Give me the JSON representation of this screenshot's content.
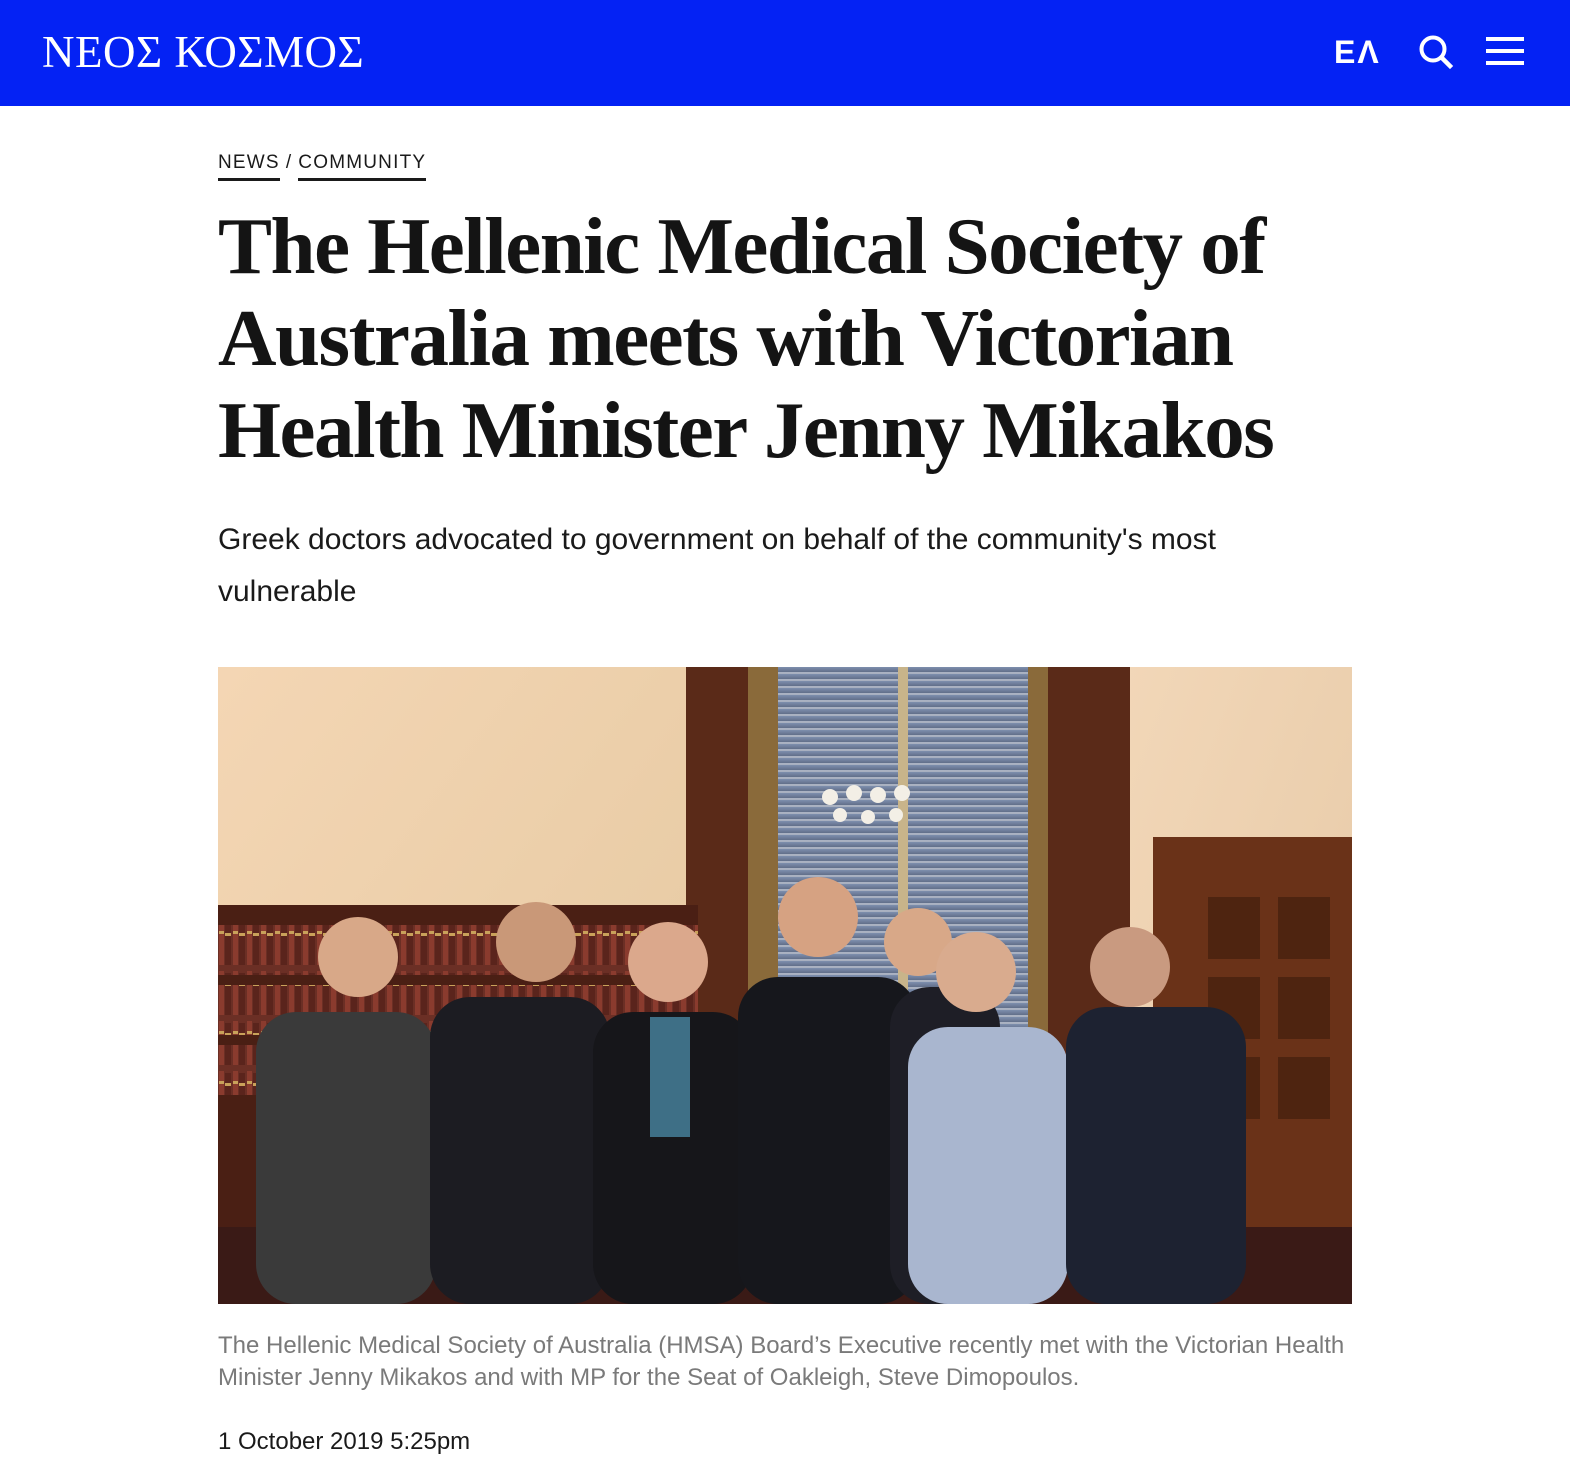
{
  "header": {
    "logo": "ΝΕΟΣ ΚΟΣΜΟΣ",
    "language_toggle": "ΕΛ",
    "search_icon": "search-icon",
    "menu_icon": "hamburger-menu-icon",
    "background_color": "#0422f4"
  },
  "breadcrumb": {
    "items": [
      "NEWS",
      "COMMUNITY"
    ],
    "separator": "/"
  },
  "article": {
    "headline": "The Hellenic Medical Society of Australia meets with Victorian Health Minister Jenny Mikakos",
    "subheadline": "Greek doctors advocated to government on behalf of the community's most vulnerable",
    "caption": "The Hellenic Medical Society of Australia (HMSA) Board’s Executive recently met with the Victorian Health Minister Jenny Mikakos and with MP for the Seat of Oakleigh, Steve Dimopoulos.",
    "date": "1 October 2019 5:25pm"
  }
}
